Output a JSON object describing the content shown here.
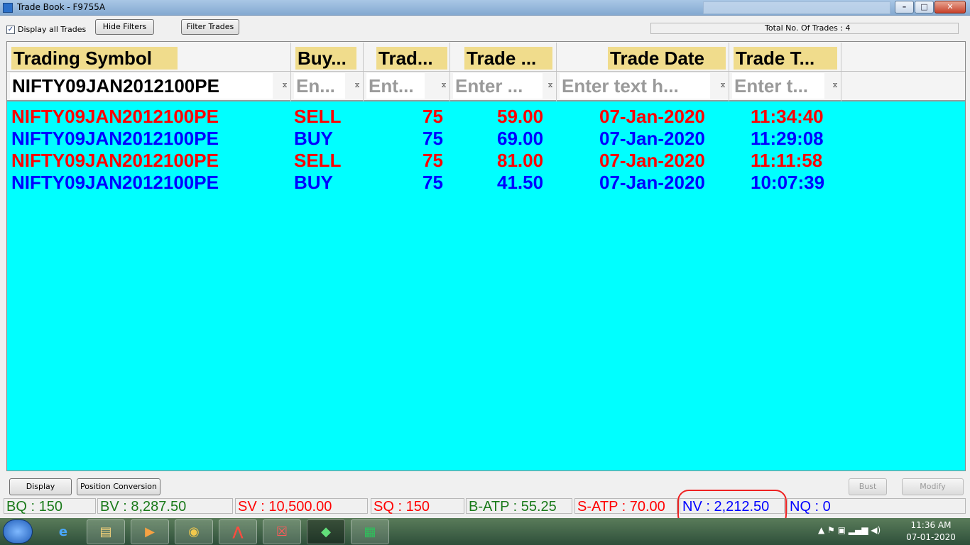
{
  "window": {
    "title": "Trade Book - F9755A",
    "min": "–",
    "max": "□",
    "close": "✕"
  },
  "toolbar": {
    "display_all_label": "Display all Trades",
    "display_all_checked": "✓",
    "hide_filters": "Hide Filters",
    "filter_trades": "Filter Trades",
    "total_trades": "Total No. Of Trades : 4"
  },
  "grid": {
    "columns": [
      "Trading Symbol",
      "Buy...",
      "Trad...",
      "Trade ...",
      "Trade Date",
      "Trade T..."
    ],
    "filters": [
      "NIFTY09JAN2012100PE",
      "En...",
      "Ent...",
      "Enter ...",
      "Enter text h...",
      "Enter t..."
    ],
    "filter_icon": "⧖",
    "rows": [
      {
        "symbol": "NIFTY09JAN2012100PE",
        "side": "SELL",
        "qty": "75",
        "price": "59.00",
        "date": "07-Jan-2020",
        "time": "11:34:40"
      },
      {
        "symbol": "NIFTY09JAN2012100PE",
        "side": "BUY",
        "qty": "75",
        "price": "69.00",
        "date": "07-Jan-2020",
        "time": "11:29:08"
      },
      {
        "symbol": "NIFTY09JAN2012100PE",
        "side": "SELL",
        "qty": "75",
        "price": "81.00",
        "date": "07-Jan-2020",
        "time": "11:11:58"
      },
      {
        "symbol": "NIFTY09JAN2012100PE",
        "side": "BUY",
        "qty": "75",
        "price": "41.50",
        "date": "07-Jan-2020",
        "time": "10:07:39"
      }
    ],
    "colors": {
      "sell": "#ff0000",
      "buy": "#0000ff",
      "background": "#00ffff",
      "header": "#f0dc8c"
    }
  },
  "actions": {
    "display": "Display",
    "position_conversion": "Position Conversion",
    "bust": "Bust",
    "modify": "Modify"
  },
  "summary": {
    "bq": "BQ : 150",
    "bv": "BV : 8,287.50",
    "sv": "SV : 10,500.00",
    "sq": "SQ : 150",
    "batp": "B-ATP : 55.25",
    "satp": "S-ATP : 70.00",
    "nv": "NV : 2,212.50",
    "nq": "NQ : 0"
  },
  "taskbar": {
    "apps": [
      "ie-icon",
      "explorer-icon",
      "media-player-icon",
      "chrome-icon",
      "acrobat-icon",
      "app-icon",
      "trading-app-icon",
      "excel-icon"
    ],
    "time": "11:36 AM",
    "date": "07-01-2020"
  }
}
